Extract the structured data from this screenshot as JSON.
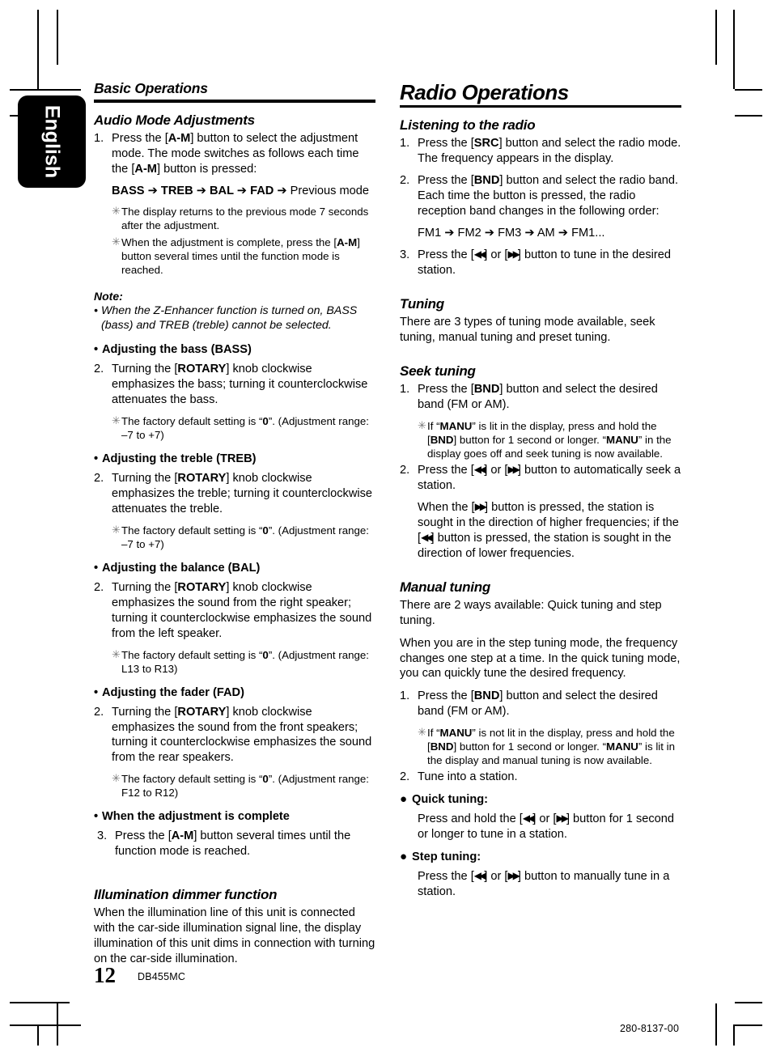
{
  "language_tab": {
    "label": "English"
  },
  "footer": {
    "page_number": "12",
    "model_code": "DB455MC",
    "document_code": "280-8137-00"
  },
  "glyphs": {
    "arrow": "➔",
    "rew": "◀◀",
    "ff": "▶▶",
    "dot": "•",
    "circle": "●",
    "star": "✳"
  },
  "left_column": {
    "section_title": "Basic Operations",
    "audio_mode": {
      "heading": "Audio Mode Adjustments",
      "step1_num": "1.",
      "step1_text_a": "Press the [",
      "step1_bold_a": "A-M",
      "step1_text_b": "] button to select the adjustment mode. The mode switches as follows each time the [",
      "step1_bold_b": "A-M",
      "step1_text_c": "] button is pressed:",
      "sequence": {
        "items": [
          "BASS",
          "TREB",
          "BAL",
          "FAD"
        ],
        "tail": "Previous mode"
      },
      "notes": [
        "The display returns to the previous mode 7 seconds after the adjustment.",
        "When the adjustment is complete, press the [A-M] button several times until the function mode is reached."
      ],
      "note2_pre": "When the adjustment is complete, press the [",
      "note2_bold": "A-M",
      "note2_post": "] button several times until the function mode is reached."
    },
    "note_block": {
      "label": "Note:",
      "bullet": "•",
      "text": "When the Z-Enhancer function is turned on, BASS (bass) and TREB (treble) cannot be selected."
    },
    "adjust_sections": [
      {
        "heading": "Adjusting the bass (BASS)",
        "num": "2.",
        "pre": "Turning the [",
        "bold": "ROTARY",
        "post": "] knob clockwise emphasizes the bass; turning it counterclockwise attenuates the bass.",
        "note_pre": "The factory default setting is “",
        "note_bold": "0",
        "note_post": "”. (Adjustment range:  –7 to +7)"
      },
      {
        "heading": "Adjusting the treble (TREB)",
        "num": "2.",
        "pre": "Turning the [",
        "bold": "ROTARY",
        "post": "] knob clockwise emphasizes the treble; turning it counterclockwise attenuates the treble.",
        "note_pre": "The factory default setting is “",
        "note_bold": "0",
        "note_post": "”. (Adjustment range:  –7 to +7)"
      },
      {
        "heading": "Adjusting the balance (BAL)",
        "num": "2.",
        "pre": "Turning the [",
        "bold": "ROTARY",
        "post": "] knob clockwise emphasizes the sound from the right speaker; turning it counterclockwise emphasizes the sound from the left speaker.",
        "note_pre": "The factory default setting is “",
        "note_bold": "0",
        "note_post": "”. (Adjustment range: L13 to R13)"
      },
      {
        "heading": "Adjusting the fader (FAD)",
        "num": "2.",
        "pre": "Turning the [",
        "bold": "ROTARY",
        "post": "] knob clockwise emphasizes the sound from the front speakers; turning it counterclockwise emphasizes the sound from the rear speakers.",
        "note_pre": "The factory default setting is “",
        "note_bold": "0",
        "note_post": "”. (Adjustment range: F12 to R12)"
      }
    ],
    "complete": {
      "heading": "When the adjustment is complete",
      "num": "3.",
      "pre": "Press the [",
      "bold": "A-M",
      "post": "] button several times until the function mode is reached."
    },
    "illumination": {
      "heading": "Illumination dimmer function",
      "text": "When the illumination line of this unit is connected with the car-side illumination signal line, the display illumination of this unit dims in connection with turning on the car-side illumination."
    }
  },
  "right_column": {
    "section_title": "Radio Operations",
    "listening": {
      "heading": "Listening to the radio",
      "step1_num": "1.",
      "step1_pre": "Press the [",
      "step1_bold": "SRC",
      "step1_post": "] button and select the radio mode. The frequency appears in the display.",
      "step2_num": "2.",
      "step2_pre": "Press the [",
      "step2_bold": "BND",
      "step2_post": "] button and select the radio band. Each time the button is pressed, the radio reception band changes in the following order:",
      "band_sequence": {
        "items": [
          "FM1",
          "FM2",
          "FM3",
          "AM"
        ],
        "tail": "FM1..."
      },
      "step3_num": "3.",
      "step3_pre": "Press the [",
      "step3_mid": "] or [",
      "step3_post": "] button to tune in the desired station."
    },
    "tuning": {
      "heading": "Tuning",
      "text": "There are 3 types of tuning mode available, seek tuning, manual tuning and preset tuning."
    },
    "seek_tuning": {
      "heading": "Seek tuning",
      "step1_num": "1.",
      "step1_pre": "Press the [",
      "step1_bold": "BND",
      "step1_post": "] button and select the desired band (FM or AM).",
      "note1_a": "If “",
      "note1_bold1": "MANU",
      "note1_b": "” is lit in the display, press and hold the [",
      "note1_bold2": "BND",
      "note1_c": "] button for 1 second or longer. “",
      "note1_bold3": "MANU",
      "note1_d": "”  in the display goes off and seek tuning is now available.",
      "step2_num": "2.",
      "step2_pre": "Press the [",
      "step2_mid": "] or [",
      "step2_post": "] button to automatically seek a station.",
      "explain_a": "When the [",
      "explain_b": "] button is pressed, the station is sought in the direction of higher frequencies; if the [",
      "explain_c": "] button is pressed, the station is sought in the direction of lower frequencies."
    },
    "manual_tuning": {
      "heading": "Manual tuning",
      "para1": "There are 2 ways available: Quick tuning and step tuning.",
      "para2": "When you are in the step tuning mode, the frequency changes one step at a time. In the quick tuning mode, you can quickly tune the desired frequency.",
      "step1_num": "1.",
      "step1_pre": "Press the [",
      "step1_bold": "BND",
      "step1_post": "] button and select the desired band (FM or AM).",
      "note1_a": "If “",
      "note1_bold1": "MANU",
      "note1_b": "” is not lit in the display, press and hold the [",
      "note1_bold2": "BND",
      "note1_c": "] button for 1 second or longer. “",
      "note1_bold3": "MANU",
      "note1_d": "” is lit in the display and manual tuning is now available.",
      "step2_num": "2.",
      "step2_text": "Tune into a station.",
      "quick": {
        "heading": "Quick tuning:",
        "pre": "Press and hold the [",
        "mid": "] or [",
        "post": "] button for 1 second or longer to tune in a station."
      },
      "step": {
        "heading": "Step tuning:",
        "pre": "Press the [",
        "mid": "] or [",
        "post": "] button to manually tune in a station."
      }
    }
  }
}
